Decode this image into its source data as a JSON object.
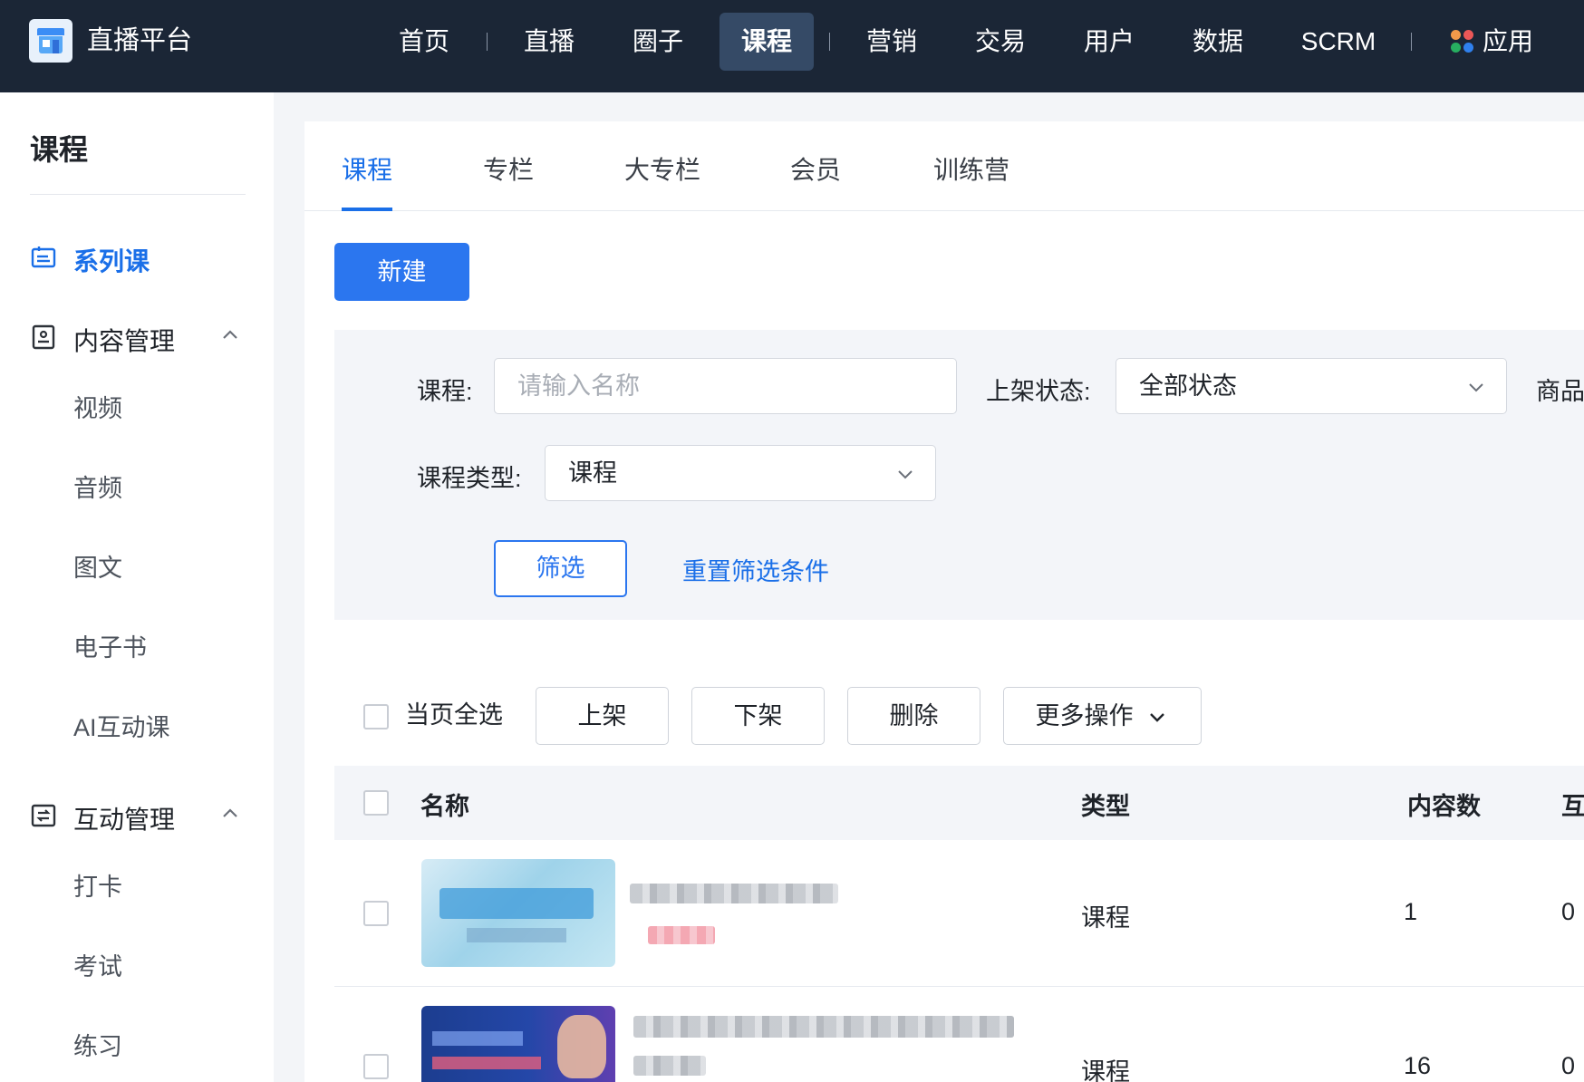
{
  "topbar": {
    "brand": "直播平台",
    "nav": [
      {
        "label": "首页",
        "active": false
      },
      {
        "label": "直播",
        "active": false
      },
      {
        "label": "圈子",
        "active": false
      },
      {
        "label": "课程",
        "active": true
      },
      {
        "label": "营销",
        "active": false
      },
      {
        "label": "交易",
        "active": false
      },
      {
        "label": "用户",
        "active": false
      },
      {
        "label": "数据",
        "active": false
      },
      {
        "label": "SCRM",
        "active": false
      },
      {
        "label": "应用",
        "active": false
      }
    ],
    "colors": {
      "bg": "#1b2636",
      "active_bg": "#354a66"
    }
  },
  "sidebar": {
    "title": "课程",
    "active_item": "系列课",
    "groups": [
      {
        "label": "内容管理",
        "expanded": true,
        "items": [
          "视频",
          "音频",
          "图文",
          "电子书",
          "AI互动课"
        ]
      },
      {
        "label": "互动管理",
        "expanded": true,
        "items": [
          "打卡",
          "考试",
          "练习"
        ]
      }
    ]
  },
  "tabs": [
    "课程",
    "专栏",
    "大专栏",
    "会员",
    "训练营"
  ],
  "active_tab": "课程",
  "new_button": "新建",
  "filter": {
    "course_label": "课程:",
    "course_placeholder": "请输入名称",
    "status_label": "上架状态:",
    "status_value": "全部状态",
    "goods_label": "商品",
    "type_label": "课程类型:",
    "type_value": "课程",
    "filter_button": "筛选",
    "reset_link": "重置筛选条件"
  },
  "bulk": {
    "select_all": "当页全选",
    "buttons": [
      "上架",
      "下架",
      "删除"
    ],
    "more": "更多操作"
  },
  "table": {
    "headers": [
      "名称",
      "类型",
      "内容数",
      "互"
    ],
    "rows": [
      {
        "type": "课程",
        "count": "1",
        "extra": "0"
      },
      {
        "type": "课程",
        "count": "16",
        "extra": "0"
      }
    ]
  },
  "accent_color": "#1a6fe8"
}
